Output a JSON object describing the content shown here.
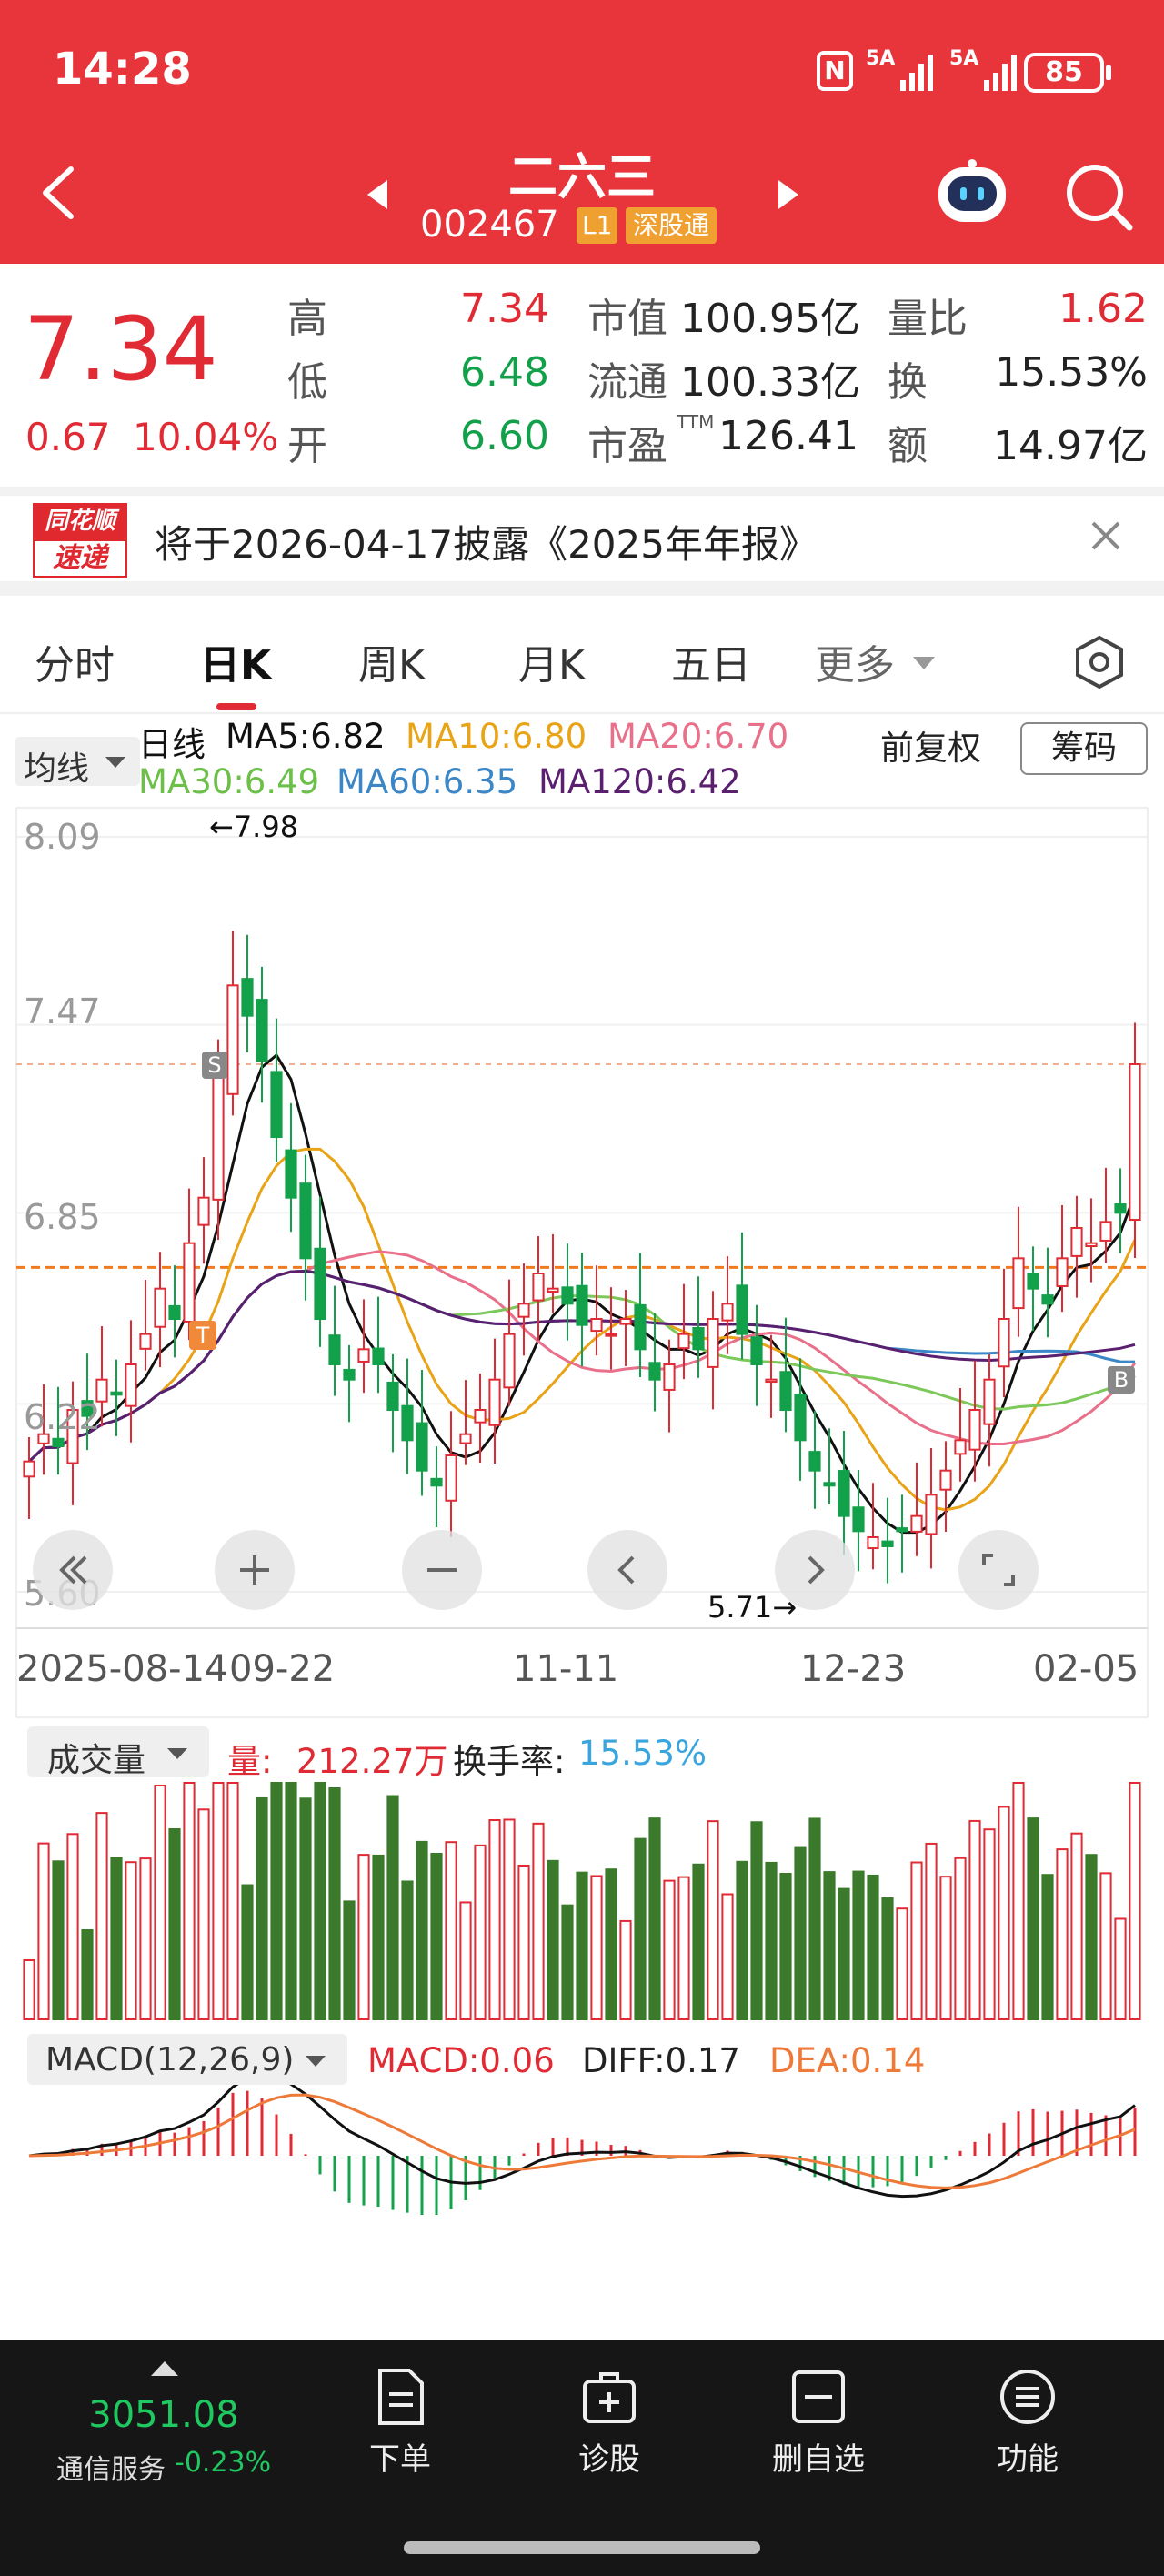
{
  "status_bar": {
    "time": "14:28",
    "nfc": "N",
    "signal1": "5A",
    "signal2": "5A",
    "battery": "85"
  },
  "header": {
    "stock_name": "二六三",
    "stock_code": "002467",
    "level_badge": "L1",
    "market_badge": "深股通"
  },
  "quote": {
    "price": "7.34",
    "change": "0.67",
    "change_pct": "10.04%",
    "high_label": "高",
    "high": "7.34",
    "low_label": "低",
    "low": "6.48",
    "open_label": "开",
    "open": "6.60",
    "mktcap_label": "市值",
    "mktcap": "100.95亿",
    "float_label": "流通",
    "float": "100.33亿",
    "pe_label": "市盈",
    "pe_sup": "TTM",
    "pe": "126.41",
    "volratio_label": "量比",
    "volratio": "1.62",
    "turnover_label": "换",
    "turnover": "15.53%",
    "amount_label": "额",
    "amount": "14.97亿"
  },
  "notice": {
    "logo_line1": "同花顺",
    "logo_line2": "速递",
    "text": "将于2026-04-17披露《2025年年报》"
  },
  "tabs": [
    {
      "label": "分时"
    },
    {
      "label": "日K"
    },
    {
      "label": "周K"
    },
    {
      "label": "月K"
    },
    {
      "label": "五日"
    },
    {
      "label": "更多"
    }
  ],
  "kline": {
    "indicator_select": "均线",
    "period_label": "日线",
    "ma5": "MA5:6.82",
    "ma10": "MA10:6.80",
    "ma20": "MA20:6.70",
    "ma30": "MA30:6.49",
    "ma60": "MA60:6.35",
    "ma120": "MA120:6.42",
    "adjust_label": "前复权",
    "chips_button": "筹码",
    "y_ticks": [
      "8.09",
      "7.47",
      "6.85",
      "6.22",
      "5.60"
    ],
    "max_marker": "←7.98",
    "min_marker": "5.71→",
    "x_ticks": [
      "2025-08-14",
      "09-22",
      "11-11",
      "12-23",
      "02-05"
    ],
    "signal_s": "S",
    "signal_t": "T",
    "signal_b": "B"
  },
  "volume": {
    "selector": "成交量",
    "vol_label": "量:",
    "vol_value": "212.27万",
    "turn_label": "换手率:",
    "turn_value": "15.53%"
  },
  "macd": {
    "selector": "MACD(12,26,9)",
    "macd": "MACD:0.06",
    "diff": "DIFF:0.17",
    "dea": "DEA:0.14"
  },
  "bottom": {
    "index_value": "3051.08",
    "index_name": "通信服务",
    "index_change": "-0.23%",
    "actions": [
      {
        "label": "下单"
      },
      {
        "label": "诊股"
      },
      {
        "label": "删自选"
      },
      {
        "label": "功能"
      }
    ]
  },
  "colors": {
    "brand_red": "#e8343b",
    "up": "#e02a34",
    "down": "#13a04a",
    "ma5": "#111111",
    "ma10": "#e8a317",
    "ma20": "#e8708a",
    "ma30": "#7cc85a",
    "ma60": "#3a86c6",
    "ma120": "#5a1f6e",
    "dea": "#ee7a3a"
  },
  "chart_data": {
    "type": "candlestick",
    "closes": [
      6.03,
      6.12,
      6.08,
      6.2,
      6.18,
      6.3,
      6.25,
      6.35,
      6.45,
      6.6,
      6.5,
      6.75,
      6.9,
      7.3,
      7.6,
      7.5,
      7.35,
      7.1,
      6.9,
      6.7,
      6.5,
      6.35,
      6.3,
      6.4,
      6.35,
      6.2,
      6.1,
      6.0,
      5.95,
      6.05,
      6.12,
      6.2,
      6.3,
      6.45,
      6.55,
      6.65,
      6.6,
      6.55,
      6.48,
      6.5,
      6.45,
      6.5,
      6.4,
      6.3,
      6.35,
      6.45,
      6.4,
      6.5,
      6.55,
      6.45,
      6.35,
      6.3,
      6.2,
      6.1,
      6.0,
      5.95,
      5.85,
      5.8,
      5.78,
      5.75,
      5.8,
      5.85,
      5.92,
      6.0,
      6.1,
      6.2,
      6.3,
      6.5,
      6.7,
      6.6,
      6.55,
      6.7,
      6.8,
      6.75,
      6.82,
      6.85,
      7.34
    ],
    "y_range": [
      5.6,
      8.09
    ]
  }
}
